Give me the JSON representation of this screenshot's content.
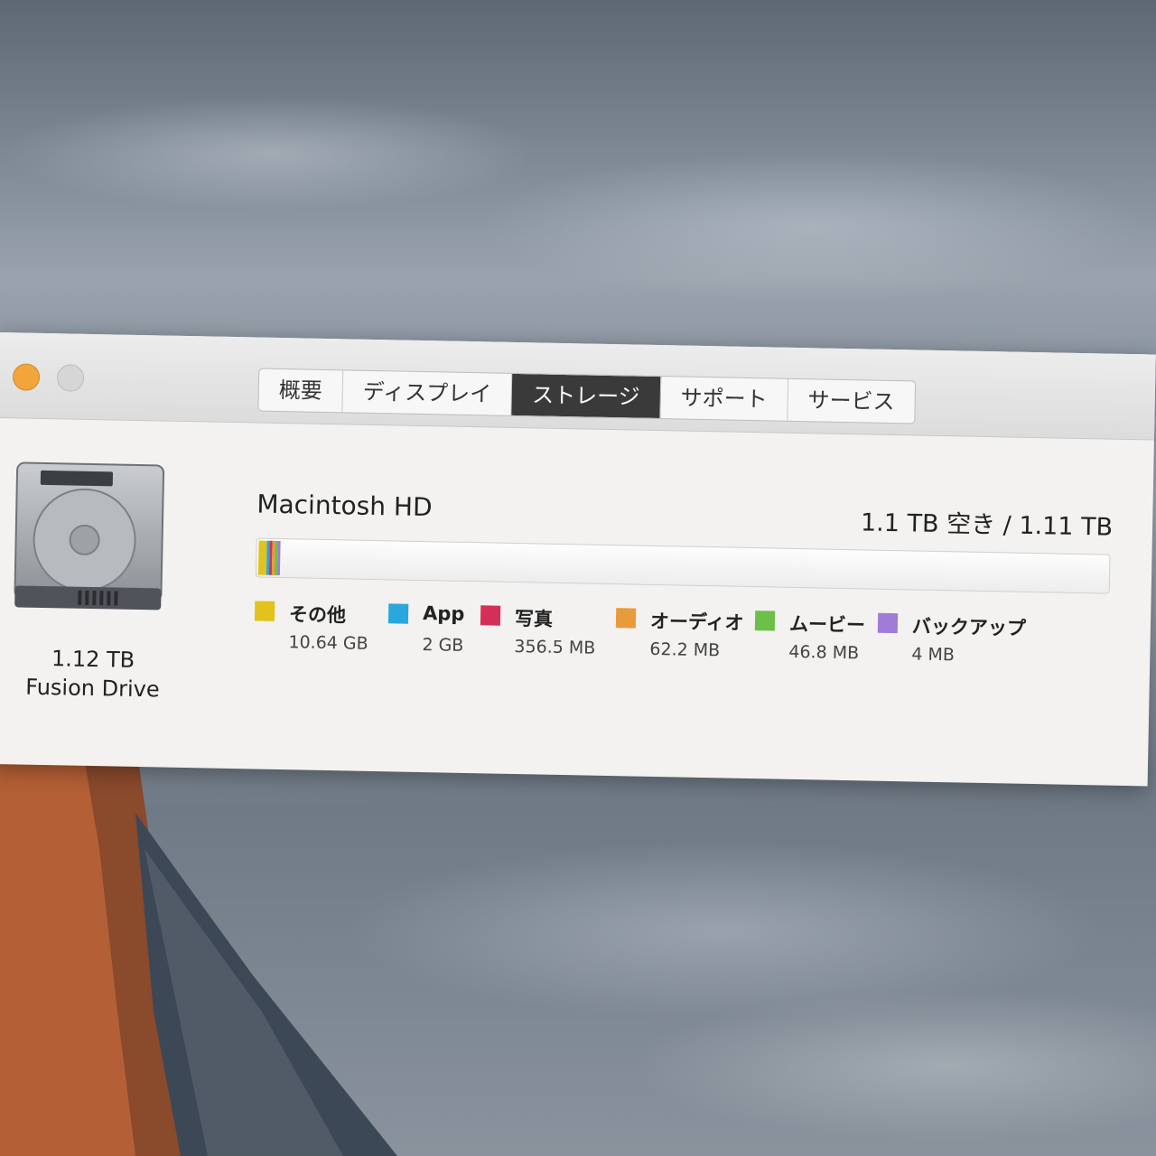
{
  "tabs": [
    {
      "label": "概要"
    },
    {
      "label": "ディスプレイ"
    },
    {
      "label": "ストレージ"
    },
    {
      "label": "サポート"
    },
    {
      "label": "サービス"
    }
  ],
  "active_tab": "ストレージ",
  "drive": {
    "size": "1.12 TB",
    "type": "Fusion Drive"
  },
  "volume": {
    "name": "Macintosh HD",
    "free_label": "1.1 TB 空き / 1.11 TB"
  },
  "legend": [
    {
      "label": "その他",
      "value": "10.64 GB",
      "color": "#e2c21d"
    },
    {
      "label": "App",
      "value": "2 GB",
      "color": "#2aa7dc"
    },
    {
      "label": "写真",
      "value": "356.5 MB",
      "color": "#d62f57"
    },
    {
      "label": "オーディオ",
      "value": "62.2 MB",
      "color": "#e99a3a"
    },
    {
      "label": "ムービー",
      "value": "46.8 MB",
      "color": "#6cc04a"
    },
    {
      "label": "バックアップ",
      "value": "4 MB",
      "color": "#a27bd8"
    }
  ],
  "usage_gb": {
    "total": 1110,
    "segments": [
      10.64,
      2,
      0.3565,
      0.0622,
      0.0468,
      0.004
    ]
  }
}
